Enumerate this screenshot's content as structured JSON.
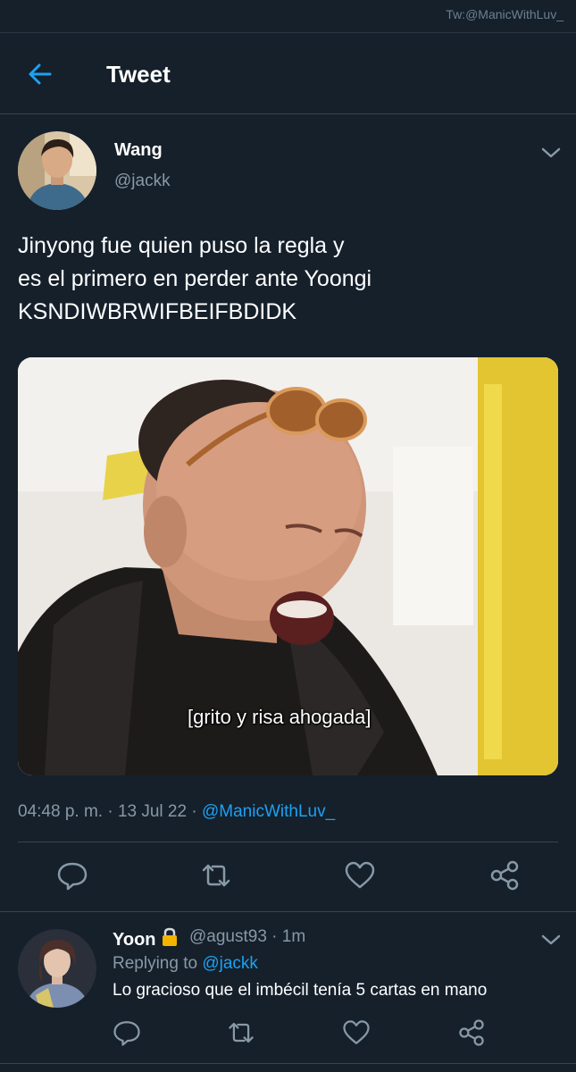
{
  "watermark": "Tw:@ManicWithLuv_",
  "header": {
    "back_icon": "arrow-left-icon",
    "title": "Tweet"
  },
  "tweet": {
    "author_name": "Wang",
    "author_handle": "@jackk",
    "text_lines": [
      "Jinyong fue quien puso la regla y",
      "es el primero en perder ante Yoongi",
      "KSNDIWBRWIFBEIFBDIDK"
    ],
    "media_subtitle": "[grito y risa ahogada]",
    "time": "04:48 p. m.",
    "date": "13 Jul 22",
    "via": "@ManicWithLuv_",
    "separator": " · "
  },
  "actions": {
    "icons": [
      "reply-icon",
      "retweet-icon",
      "like-icon",
      "share-icon"
    ]
  },
  "reply": {
    "author_name": "Yoon",
    "lock_icon": "lock-icon",
    "handle_time": "@agust93 · 1m",
    "replying_to_label": "Replying to",
    "replying_to_handle": "@jackk",
    "text": "Lo gracioso que el imbécil tenía 5 cartas en mano"
  },
  "colors": {
    "background": "#15202b",
    "accent": "#1da1f2",
    "secondary_text": "#8899a6",
    "divider": "#38444d",
    "lock": "#f4b400"
  }
}
